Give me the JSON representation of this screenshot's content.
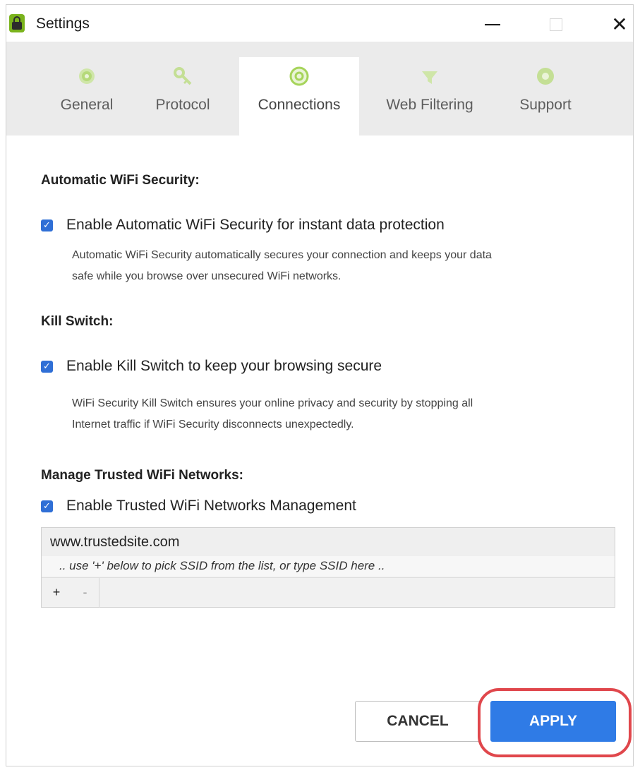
{
  "window": {
    "title": "Settings",
    "icon": "padlock-app-icon",
    "controls": [
      "minimize-icon",
      "maximize-icon",
      "close-icon"
    ],
    "close_glyph": "✕"
  },
  "tabs": [
    {
      "label": "General",
      "icon": "gear-icon",
      "active": false
    },
    {
      "label": "Protocol",
      "icon": "key-icon",
      "active": false
    },
    {
      "label": "Connections",
      "icon": "connection-icon",
      "active": true
    },
    {
      "label": "Web Filtering",
      "icon": "filter-icon",
      "active": false
    },
    {
      "label": "Support",
      "icon": "lifebuoy-icon",
      "active": false
    }
  ],
  "wifi_security": {
    "title": "Automatic WiFi Security:",
    "checkbox_label": "Enable Automatic WiFi Security for instant data protection",
    "checked": true,
    "description_line1": "Automatic WiFi Security automatically secures your connection and keeps your data",
    "description_line2": "safe while you browse over unsecured WiFi networks."
  },
  "kill_switch": {
    "title": "Kill Switch:",
    "checkbox_label": "Enable Kill Switch to keep your browsing secure",
    "checked": true,
    "description_line1": "WiFi Security Kill Switch ensures your online privacy and security by stopping all",
    "description_line2": "Internet traffic if WiFi Security disconnects unexpectedly."
  },
  "trusted_networks": {
    "title": "Manage Trusted WiFi Networks:",
    "checkbox_label": "Enable Trusted WiFi Networks Management",
    "checked": true,
    "entries": [
      "www.trustedsite.com"
    ],
    "hint": ".. use '+' below to pick SSID from the list, or type SSID here ..",
    "add_label": "+",
    "remove_label": "-"
  },
  "buttons": {
    "cancel": "CANCEL",
    "apply": "APPLY"
  },
  "colors": {
    "accent_green": "#8cc63f",
    "checkbox_blue": "#2f6fd6",
    "apply_blue": "#2f7be6",
    "highlight_red": "#e0474c"
  }
}
